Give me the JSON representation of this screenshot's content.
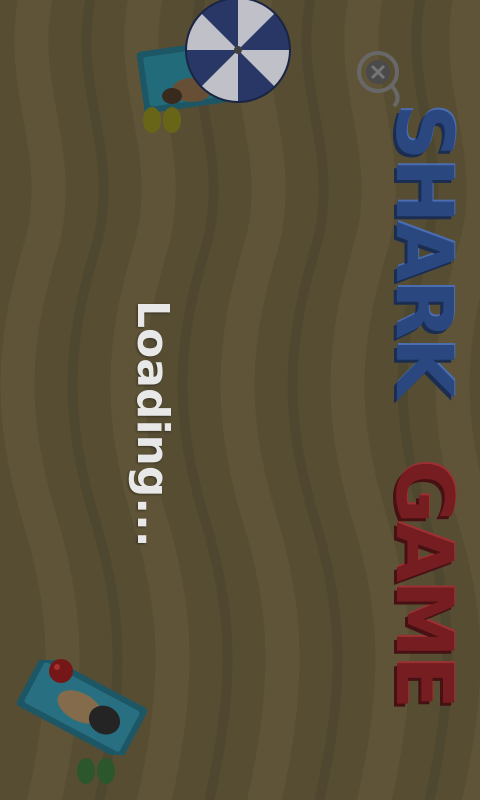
{
  "title": {
    "word1": "SHARK",
    "word2": "GAME"
  },
  "status": {
    "loading_text": "Loading..."
  },
  "icons": {
    "title_hook": "hook-icon",
    "umbrella": "beach-umbrella-icon",
    "sunbather_top": "sunbather-icon",
    "sunbather_bottom": "sunbather-icon",
    "beach_ball": "beach-ball-icon",
    "flip_flops": "flip-flops-icon"
  },
  "colors": {
    "sand": "#5a5136",
    "shark_title": "#2c4a86",
    "game_title": "#7a1f22",
    "loading_text": "#f2f2f2"
  }
}
